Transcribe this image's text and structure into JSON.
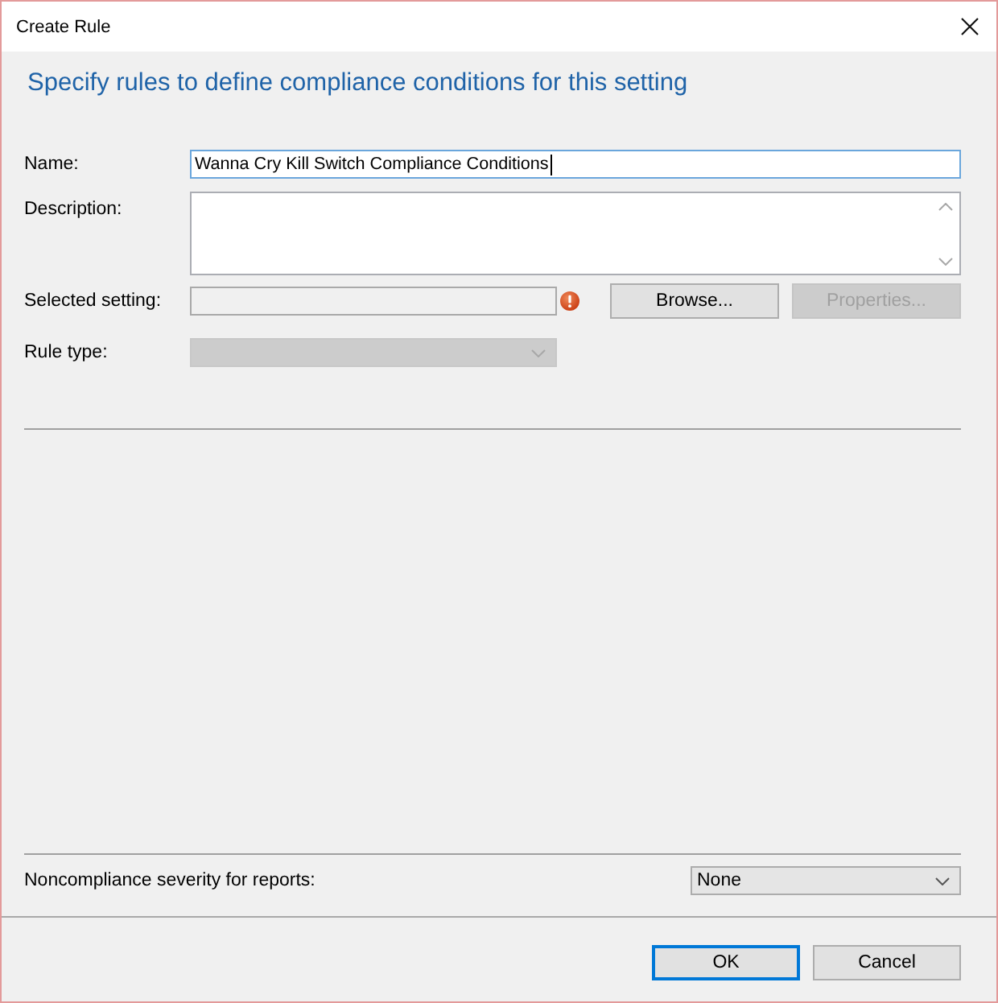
{
  "window": {
    "title": "Create Rule"
  },
  "heading": "Specify rules to define compliance conditions for this setting",
  "fields": [
    {
      "kind": "text",
      "label": "Name:",
      "value": "Wanna Cry Kill Switch Compliance Conditions",
      "focused": true,
      "disabled": false
    },
    {
      "kind": "textarea",
      "label": "Description:",
      "focused": false,
      "disabled": false
    },
    {
      "kind": "setting",
      "label": "Selected setting:",
      "focused": false,
      "disabled": true,
      "error": true,
      "buttons": [
        {
          "label": "Browse...",
          "disabled": false
        },
        {
          "label": "Properties...",
          "disabled": true
        }
      ]
    },
    {
      "kind": "dropdown",
      "label": "Rule type:",
      "focused": false,
      "disabled": true
    }
  ],
  "severity": {
    "label": "Noncompliance severity for reports:",
    "value": "None"
  },
  "buttons": [
    {
      "label": "OK",
      "default": true
    },
    {
      "label": "Cancel",
      "default": false
    }
  ]
}
